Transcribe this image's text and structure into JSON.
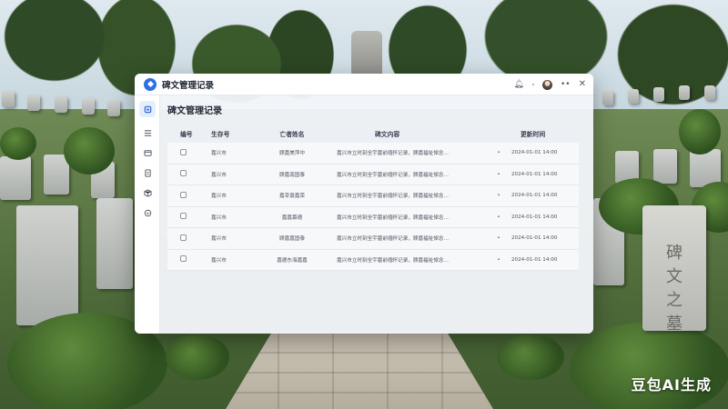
{
  "app": {
    "title": "碑文管理记录"
  },
  "page": {
    "title": "碑文管理记录"
  },
  "table": {
    "columns": [
      "编号",
      "生存号",
      "亡者姓名",
      "碑文内容",
      "",
      "更新时间"
    ],
    "rows": [
      {
        "no": "",
        "a": "嘉兴市",
        "b": "顾嘉美萍中",
        "c": "嘉兴市立时刻全宇墓前缅怀记录，顾嘉福祉悼念…",
        "d": "•",
        "e": "2024-01-01 14:00"
      },
      {
        "no": "",
        "a": "嘉兴市",
        "b": "顾嘉南国泰",
        "c": "嘉兴市立时刻全宇墓前缅怀记录，顾嘉福祉悼念…",
        "d": "•",
        "e": "2024-01-01 14:00"
      },
      {
        "no": "",
        "a": "嘉兴市",
        "b": "嘉宰景嘉荣",
        "c": "嘉兴市立时刻全宇墓前缅怀记录，顾嘉福祉悼念…",
        "d": "•",
        "e": "2024-01-01 14:00"
      },
      {
        "no": "",
        "a": "嘉兴市",
        "b": "嘉嘉慕德",
        "c": "嘉兴市立时刻全宇墓前缅怀记录，顾嘉福祉悼念…",
        "d": "•",
        "e": "2024-01-01 14:00"
      },
      {
        "no": "",
        "a": "嘉兴市",
        "b": "顾嘉嘉国泰",
        "c": "嘉兴市立时刻全宇墓前缅怀记录，顾嘉福祉悼念…",
        "d": "•",
        "e": "2024-01-01 14:00"
      },
      {
        "no": "",
        "a": "嘉兴市",
        "b": "嘉德东海嘉嘉",
        "c": "嘉兴市立时刻全宇墓前缅怀记录，顾嘉福祉悼念…",
        "d": "•",
        "e": "2024-01-01 14:00"
      }
    ]
  },
  "icons": {
    "titlebar": [
      "bell-icon",
      "avatar",
      "more-icon",
      "close-icon"
    ],
    "sidebar": [
      "home-icon",
      "list-icon",
      "folder-icon",
      "document-icon",
      "box-icon",
      "settings-icon"
    ]
  },
  "background": {
    "stone_text": "碑文之墓",
    "watermark": "豆包AI生成"
  },
  "colors": {
    "accent": "#2f6fe4",
    "title_text": "#1f2533",
    "window_bg": "#f3f5f9"
  }
}
